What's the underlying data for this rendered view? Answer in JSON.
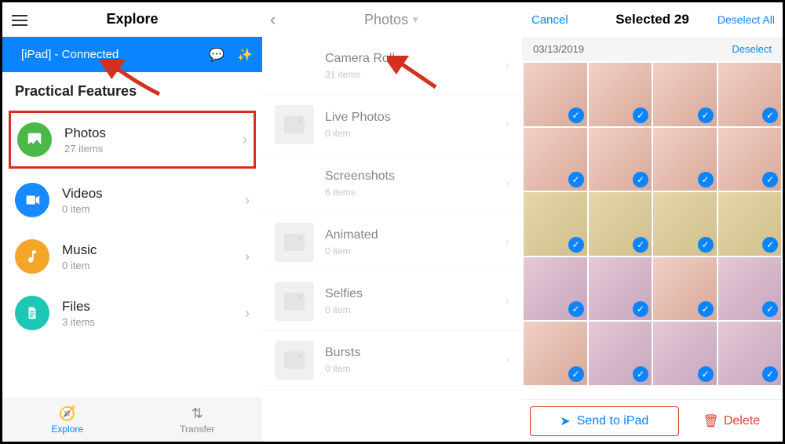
{
  "left": {
    "header_title": "Explore",
    "banner_text": "[iPad] - Connected",
    "section_title": "Practical Features",
    "features": [
      {
        "label": "Photos",
        "sub": "27 items"
      },
      {
        "label": "Videos",
        "sub": "0 item"
      },
      {
        "label": "Music",
        "sub": "0 item"
      },
      {
        "label": "Files",
        "sub": "3 items"
      }
    ],
    "tab_explore": "Explore",
    "tab_transfer": "Transfer"
  },
  "mid": {
    "header_title": "Photos",
    "albums": [
      {
        "label": "Camera Roll",
        "sub": "31 items",
        "collage": true
      },
      {
        "label": "Live Photos",
        "sub": "0 item",
        "collage": false
      },
      {
        "label": "Screenshots",
        "sub": "6 items",
        "collage": true
      },
      {
        "label": "Animated",
        "sub": "0 item",
        "collage": false
      },
      {
        "label": "Selfies",
        "sub": "0 item",
        "collage": false
      },
      {
        "label": "Bursts",
        "sub": "0 item",
        "collage": false
      }
    ]
  },
  "right": {
    "cancel": "Cancel",
    "selected_title": "Selected 29",
    "deselect_all": "Deselect All",
    "date": "03/13/2019",
    "deselect": "Deselect",
    "send_label": "Send to iPad",
    "delete_label": "Delete"
  }
}
